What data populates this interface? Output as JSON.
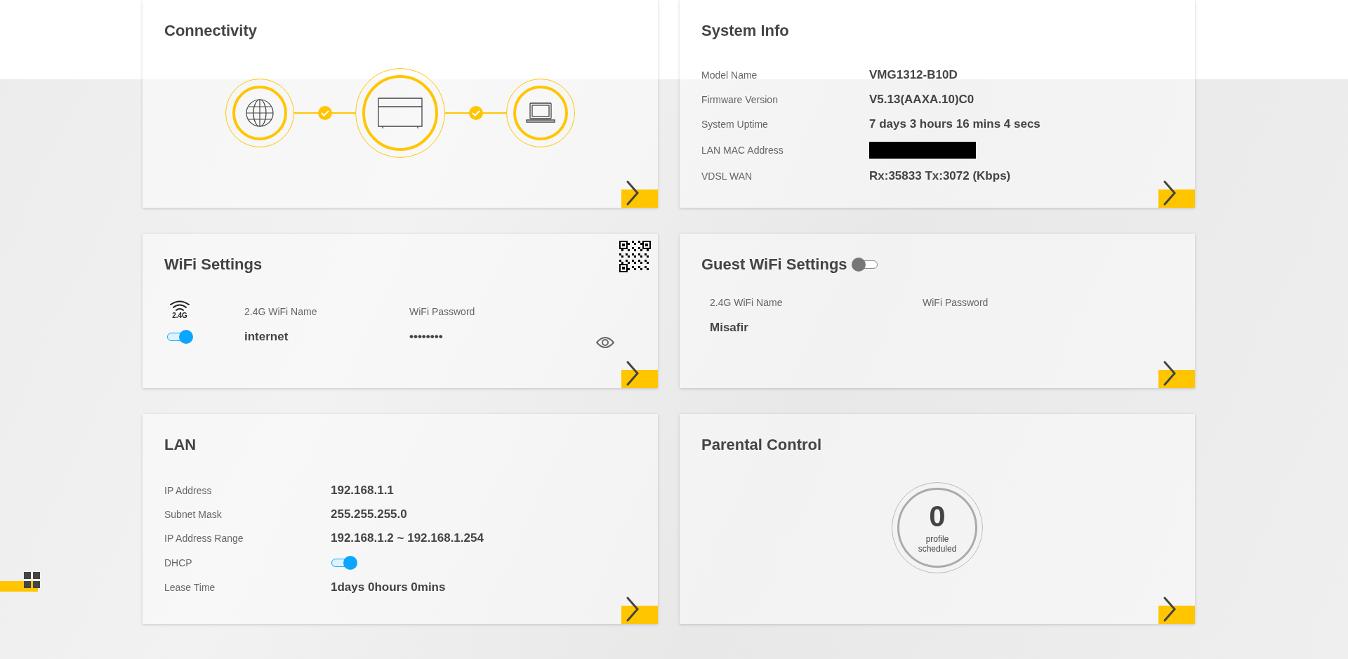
{
  "connectivity": {
    "title": "Connectivity",
    "links": [
      {
        "connected": true
      },
      {
        "connected": true
      }
    ]
  },
  "system_info": {
    "title": "System Info",
    "rows": [
      {
        "label": "Model Name",
        "kind": "text",
        "value": "VMG1312-B10D"
      },
      {
        "label": "Firmware Version",
        "kind": "text",
        "value": "V5.13(AAXA.10)C0"
      },
      {
        "label": "System Uptime",
        "kind": "text",
        "value": "7 days 3 hours 16 mins 4 secs"
      },
      {
        "label": "LAN MAC Address",
        "kind": "redacted"
      },
      {
        "label": "VDSL WAN",
        "kind": "text",
        "value": "Rx:35833 Tx:3072 (Kbps)"
      }
    ]
  },
  "wifi": {
    "title": "WiFi Settings",
    "band": "2.4G",
    "enabled": true,
    "name_label": "2.4G WiFi Name",
    "name": "internet",
    "password_label": "WiFi Password",
    "password": "••••••••"
  },
  "guest_wifi": {
    "title": "Guest WiFi Settings",
    "enabled": false,
    "name_label": "2.4G WiFi Name",
    "name": "Misafir",
    "password_label": "WiFi Password"
  },
  "lan": {
    "title": "LAN",
    "rows": [
      {
        "label": "IP Address",
        "kind": "text",
        "value": "192.168.1.1"
      },
      {
        "label": "Subnet Mask",
        "kind": "text",
        "value": "255.255.255.0"
      },
      {
        "label": "IP Address Range",
        "kind": "text",
        "value": "192.168.1.2 ~ 192.168.1.254"
      },
      {
        "label": "DHCP",
        "kind": "toggle",
        "on": true
      },
      {
        "label": "Lease Time",
        "kind": "text",
        "value": "1days 0hours 0mins"
      }
    ]
  },
  "parental_control": {
    "title": "Parental Control",
    "count": "0",
    "caption": "profile scheduled"
  }
}
